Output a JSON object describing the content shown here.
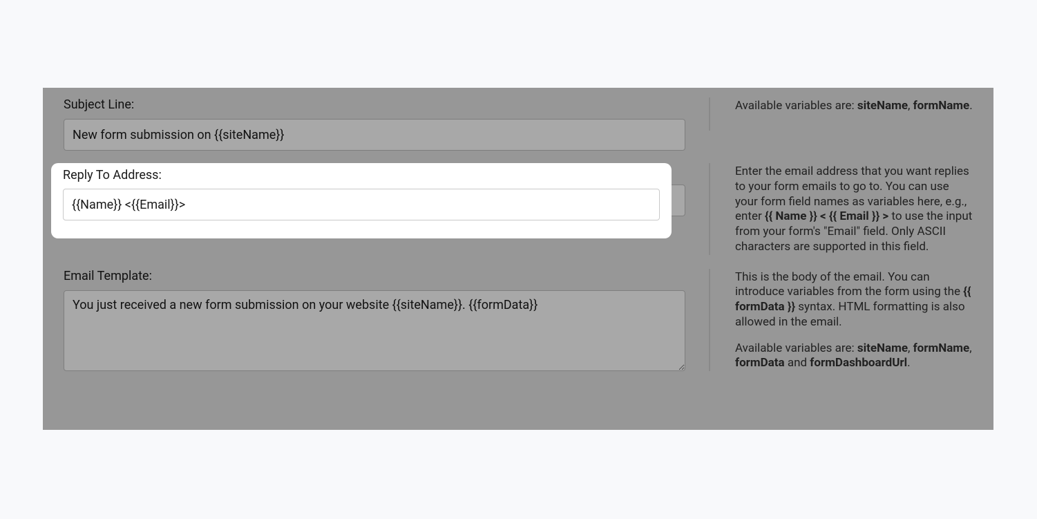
{
  "subject": {
    "label": "Subject Line:",
    "value": "New form submission on {{siteName}}",
    "help_prefix": "Available variables are: ",
    "vars": [
      "siteName",
      "formName"
    ],
    "help_suffix": "."
  },
  "replyto": {
    "label": "Reply To Address:",
    "value": "{{Name}} <{{Email}}>",
    "help_prefix": "Enter the email address that you want replies to your form emails to go to. You can use your form field names as variables here, e.g., enter ",
    "var": "{{ Name }} < {{ Email }} >",
    "help_suffix": " to use the input from your form's \"Email\" field. Only ASCII characters are supported in this field."
  },
  "template": {
    "label": "Email Template:",
    "value": "You just received a new form submission on your website {{siteName}}. {{formData}}",
    "body_help_prefix": "This is the body of the email. You can introduce variables from the form using the ",
    "body_var": "{{ formData }}",
    "body_help_suffix": " syntax. HTML formatting is also allowed in the email.",
    "vars_prefix": "Available variables are: ",
    "vars": [
      "siteName",
      "formName",
      "formData"
    ],
    "vars_connector": " and ",
    "vars_last": "formDashboardUrl",
    "vars_suffix": "."
  }
}
